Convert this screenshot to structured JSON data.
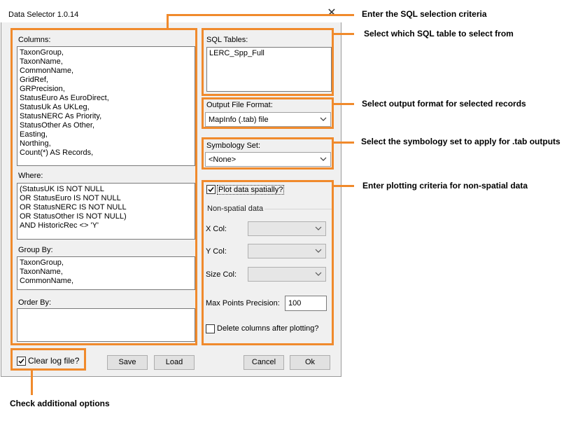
{
  "window": {
    "title": "Data Selector 1.0.14",
    "close_glyph": "✕"
  },
  "columns": {
    "label": "Columns:",
    "lines": [
      "TaxonGroup,",
      "TaxonName,",
      "CommonName,",
      "GridRef,",
      "GRPrecision,",
      "StatusEuro As EuroDirect,",
      "StatusUk As UKLeg,",
      "StatusNERC As Priority,",
      "StatusOther As Other,",
      "Easting,",
      "Northing,",
      "Count(*) AS Records,"
    ]
  },
  "where": {
    "label": "Where:",
    "lines": [
      "(StatusUK IS NOT NULL",
      "OR StatusEuro IS NOT NULL",
      "OR StatusNERC IS NOT NULL",
      "OR StatusOther IS NOT NULL)",
      "AND HistoricRec <> 'Y'"
    ]
  },
  "group_by": {
    "label": "Group By:",
    "lines": [
      "TaxonGroup,",
      "TaxonName,",
      "CommonName,"
    ]
  },
  "order_by": {
    "label": "Order By:",
    "lines": []
  },
  "sql_tables": {
    "label": "SQL Tables:",
    "items": [
      "LERC_Spp_Full"
    ]
  },
  "output_format": {
    "label": "Output File Format:",
    "value": "MapInfo (.tab) file"
  },
  "symbology": {
    "label": "Symbology Set:",
    "value": "<None>"
  },
  "plot": {
    "checkbox_label": "Plot data spatially?",
    "checked": true,
    "group_label": "Non-spatial data",
    "x_col_label": "X Col:",
    "y_col_label": "Y Col:",
    "size_col_label": "Size Col:",
    "precision_label": "Max Points Precision:",
    "precision_value": "100",
    "delete_label": "Delete columns after plotting?",
    "delete_checked": false
  },
  "clear_log": {
    "label": "Clear log file?",
    "checked": true
  },
  "buttons": {
    "save": "Save",
    "load": "Load",
    "cancel": "Cancel",
    "ok": "Ok"
  },
  "callouts": {
    "sql_criteria": "Enter the SQL selection criteria",
    "sql_table": "Select which SQL table to select from",
    "output_format": "Select output format for selected records",
    "symbology": "Select the symbology set to apply for .tab outputs",
    "plotting": "Enter plotting criteria for non-spatial data",
    "options": "Check additional options"
  },
  "colors": {
    "accent": "#f08a2c",
    "window_bg": "#f0f0f0"
  }
}
